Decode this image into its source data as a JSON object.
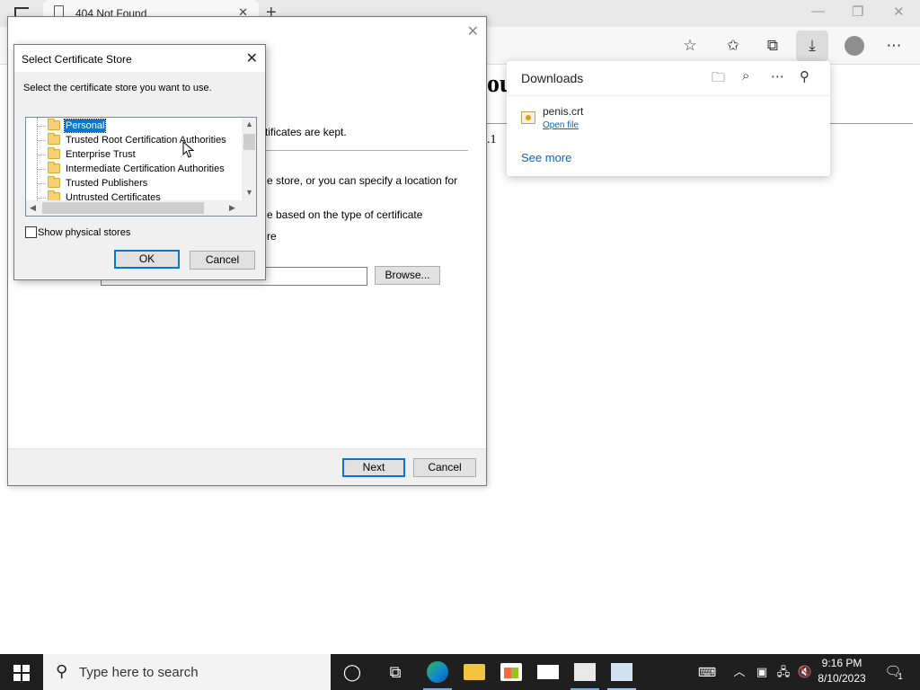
{
  "browser": {
    "tab_title": "404 Not Found",
    "tab_close": "✕",
    "new_tab": "+",
    "minimize": "—",
    "restore": "❐",
    "close": "✕",
    "page_heading": "ou",
    "page_text": ".1"
  },
  "downloads": {
    "title": "Downloads",
    "file_name": "penis.crt",
    "open_file": "Open file",
    "see_more": "See more"
  },
  "wizard": {
    "text_kept": "rtificates are kept.",
    "text_store": "e store, or you can specify a location for",
    "text_based": "e based on the type of certificate",
    "text_re": "re",
    "browse_label": "Browse...",
    "next_label": "Next",
    "cancel_label": "Cancel",
    "close": "✕"
  },
  "store_dialog": {
    "title": "Select Certificate Store",
    "close": "✕",
    "instruction": "Select the certificate store you want to use.",
    "items": [
      {
        "label": "Personal"
      },
      {
        "label": "Trusted Root Certification Authorities"
      },
      {
        "label": "Enterprise Trust"
      },
      {
        "label": "Intermediate Certification Authorities"
      },
      {
        "label": "Trusted Publishers"
      },
      {
        "label": "Untrusted Certificates"
      }
    ],
    "selected_index": 0,
    "show_physical_label": "Show physical stores",
    "show_physical_checked": false,
    "ok_label": "OK",
    "cancel_label": "Cancel"
  },
  "taskbar": {
    "search_placeholder": "Type here to search",
    "time": "9:16 PM",
    "date": "8/10/2023",
    "notification_count": "1"
  }
}
